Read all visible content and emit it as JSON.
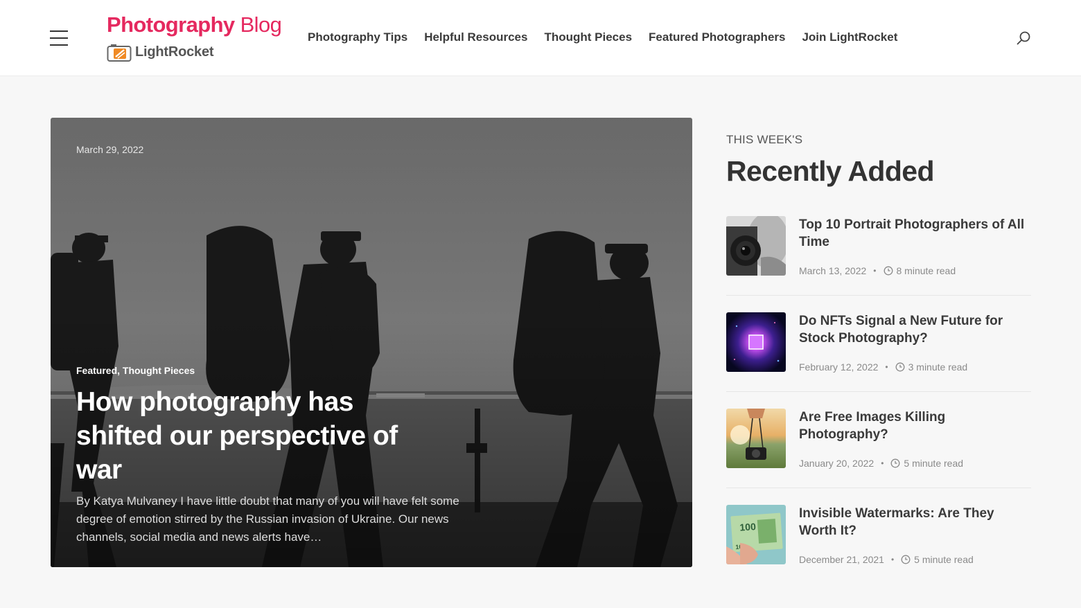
{
  "header": {
    "logo_bold": "Photography",
    "logo_light": "Blog",
    "logo_sub": "LightRocket",
    "nav": [
      {
        "label": "Photography Tips"
      },
      {
        "label": "Helpful Resources"
      },
      {
        "label": "Thought Pieces"
      },
      {
        "label": "Featured Photographers"
      },
      {
        "label": "Join LightRocket"
      }
    ],
    "icons": {
      "menu": "hamburger-icon",
      "search": "search-icon"
    }
  },
  "hero": {
    "date": "March 29, 2022",
    "categories": [
      "Featured",
      "Thought Pieces"
    ],
    "category_separator": ",",
    "title": "How photography has shifted our perspective of war",
    "excerpt": "By Katya Mulvaney I have little doubt that many of you will have felt some degree of emotion stirred by the Russian invasion of Ukraine. Our news channels, social media and news alerts have…"
  },
  "sidebar": {
    "kicker": "THIS WEEK'S",
    "heading": "Recently Added",
    "posts": [
      {
        "title": "Top 10 Portrait Photographers of All Time",
        "date": "March 13, 2022",
        "read_time": "8 minute read"
      },
      {
        "title": "Do NFTs Signal a New Future for Stock Photography?",
        "date": "February 12, 2022",
        "read_time": "3 minute read"
      },
      {
        "title": "Are Free Images Killing Photography?",
        "date": "January 20, 2022",
        "read_time": "5 minute read"
      },
      {
        "title": "Invisible Watermarks: Are They Worth It?",
        "date": "December 21, 2021",
        "read_time": "5 minute read"
      }
    ],
    "meta_separator": "•"
  },
  "colors": {
    "brand": "#e5295f",
    "text": "#3a3a3a",
    "muted": "#8a8a8a",
    "background": "#f7f7f7"
  }
}
